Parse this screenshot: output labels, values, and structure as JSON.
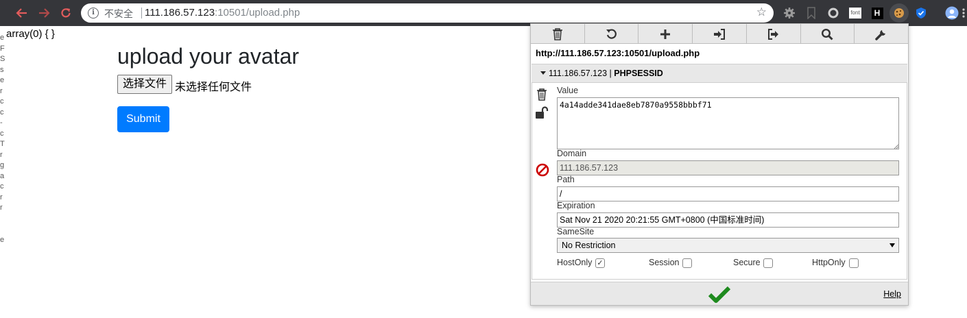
{
  "browser": {
    "security_label": "不安全",
    "url_host": "111.186.57.123",
    "url_rest": ":10501/upload.php"
  },
  "extensions": [
    "settings-gear-extension",
    "bookmark-extension",
    "circle-extension",
    "font-extension",
    "h-extension",
    "cookie-extension",
    "shield-extension",
    "profile-avatar"
  ],
  "page": {
    "left_strip_text": "e\nF\nS\ns\ne\nr\nc\nc\n-\nc\nT\nr\ng\na\nc\nr\nr\n\n\ne",
    "dump_text": "array(0) { }",
    "heading": "upload your avatar",
    "file_button_label": "选择文件",
    "file_status": "未选择任何文件",
    "submit_label": "Submit"
  },
  "cookie_editor": {
    "toolbar": [
      "delete-all-cookies",
      "refresh-cookies",
      "add-cookie",
      "import-cookies",
      "export-cookies",
      "search-cookies",
      "options"
    ],
    "url": "http://111.186.57.123:10501/upload.php",
    "cookie_domain": "111.186.57.123",
    "cookie_separator": " | ",
    "cookie_name": "PHPSESSID",
    "value_label": "Value",
    "value": "4a14adde341dae8eb7870a9558bbbf71",
    "domain_label": "Domain",
    "domain": "111.186.57.123",
    "path_label": "Path",
    "path": "/",
    "expiration_label": "Expiration",
    "expiration": "Sat Nov 21 2020 20:21:55 GMT+0800 (中国标准时间)",
    "samesite_label": "SameSite",
    "samesite": "No Restriction",
    "hostonly_label": "HostOnly",
    "hostonly_checked": true,
    "session_label": "Session",
    "session_checked": false,
    "secure_label": "Secure",
    "secure_checked": false,
    "httponly_label": "HttpOnly",
    "httponly_checked": false,
    "help_label": "Help",
    "accent_green": "#1e8a1e",
    "block_red": "#cc0000"
  },
  "colors": {
    "toolbar_bg": "#35363a",
    "nav_red": "#e25c5c",
    "submit_blue": "#007bff"
  }
}
